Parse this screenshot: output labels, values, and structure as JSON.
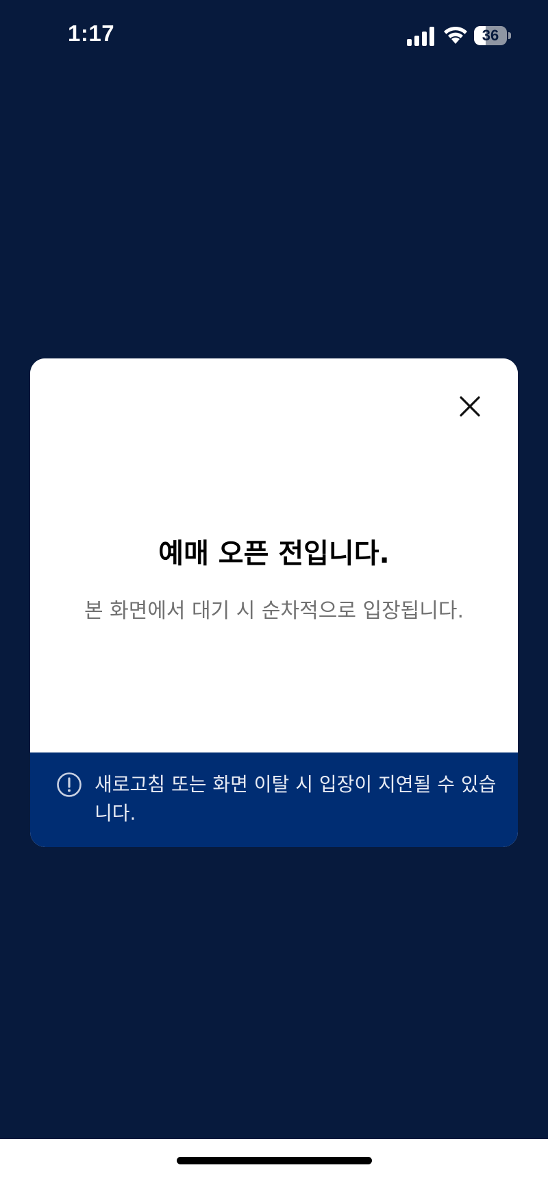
{
  "status_bar": {
    "time": "1:17",
    "battery_level": "36",
    "battery_fraction": 0.36
  },
  "modal": {
    "title": "예매 오픈 전입니다.",
    "subtitle": "본 화면에서 대기 시 순차적으로 입장됩니다.",
    "close_icon": "close-icon",
    "notice": {
      "icon": "exclamation-circle-icon",
      "text": "새로고침 또는 화면 이탈 시 입장이 지연될 수 있습니다."
    }
  },
  "colors": {
    "background": "#071a3d",
    "modal_background": "#ffffff",
    "notice_background": "#002d73",
    "title_text": "#000000",
    "subtitle_text": "#707070",
    "notice_text": "#e8ecf4"
  }
}
